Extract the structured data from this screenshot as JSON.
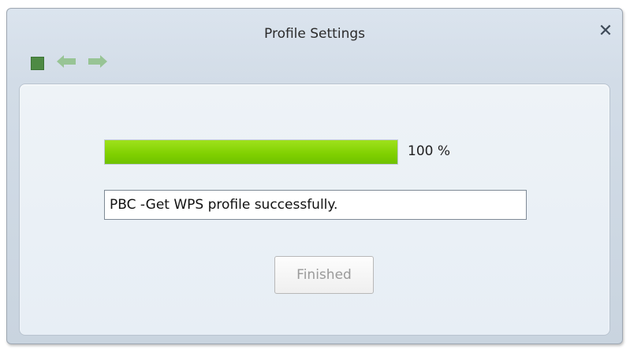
{
  "window": {
    "title": "Profile Settings",
    "close_icon": "close-icon"
  },
  "toolbar": {
    "stop_icon": "stop-icon",
    "back_icon": "arrow-left-icon",
    "forward_icon": "arrow-right-icon"
  },
  "progress": {
    "value_percent": 100,
    "label": "100 %",
    "fill_color": "#7fd000"
  },
  "status": {
    "value": "PBC -Get WPS profile successfully."
  },
  "buttons": {
    "finished_label": "Finished",
    "finished_disabled": true
  }
}
